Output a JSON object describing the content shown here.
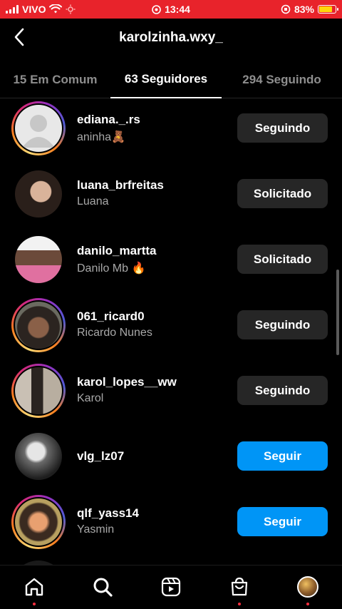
{
  "status_bar": {
    "carrier": "VIVO",
    "time": "13:44",
    "battery": "83%",
    "battery_level": 0.83,
    "background_color": "#e8232b"
  },
  "header": {
    "title": "karolzinha.wxy_",
    "back_icon": "chevron-left-icon"
  },
  "tabs": [
    {
      "label": "15 Em Comum",
      "active": false
    },
    {
      "label": "63 Seguidores",
      "active": true
    },
    {
      "label": "294 Seguindo",
      "active": false
    }
  ],
  "rows": [
    {
      "username": "ediana._.rs",
      "fullname": "aninha🧸",
      "button": "Seguindo",
      "button_style": "secondary",
      "story_ring": true
    },
    {
      "username": "luana_brfreitas",
      "fullname": "Luana",
      "button": "Solicitado",
      "button_style": "secondary",
      "story_ring": false
    },
    {
      "username": "danilo_martta",
      "fullname": "Danilo Mb 🔥",
      "button": "Solicitado",
      "button_style": "secondary",
      "story_ring": false
    },
    {
      "username": "061_ricard0",
      "fullname": "Ricardo Nunes",
      "button": "Seguindo",
      "button_style": "secondary",
      "story_ring": true
    },
    {
      "username": "karol_lopes__ww",
      "fullname": "Karol",
      "button": "Seguindo",
      "button_style": "secondary",
      "story_ring": true
    },
    {
      "username": "vlg_lz07",
      "fullname": "",
      "button": "Seguir",
      "button_style": "primary",
      "story_ring": false
    },
    {
      "username": "qlf_yass14",
      "fullname": "Yasmin",
      "button": "Seguir",
      "button_style": "primary",
      "story_ring": true
    }
  ],
  "bottom_nav": [
    {
      "name": "home-icon",
      "notification_dot": true
    },
    {
      "name": "search-icon",
      "notification_dot": false
    },
    {
      "name": "reels-icon",
      "notification_dot": false
    },
    {
      "name": "shop-icon",
      "notification_dot": true
    },
    {
      "name": "profile-avatar",
      "notification_dot": true
    }
  ],
  "colors": {
    "primary_button": "#0095f6",
    "secondary_button": "#262626",
    "muted_text": "#a8a8a8",
    "notification_dot": "#ff3040"
  }
}
